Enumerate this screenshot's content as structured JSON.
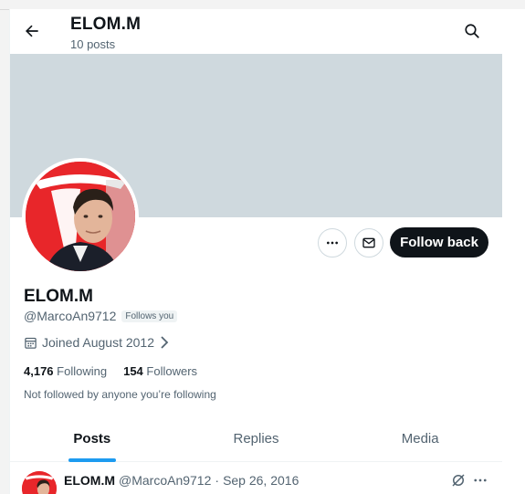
{
  "header": {
    "name": "ELOM.M",
    "posts_count": "10 posts"
  },
  "profile": {
    "display_name": "ELOM.M",
    "handle": "@MarcoAn9712",
    "follows_you": "Follows you",
    "joined": "Joined August 2012",
    "following_count": "4,176",
    "following_label": "Following",
    "followers_count": "154",
    "followers_label": "Followers",
    "not_followed": "Not followed by anyone you’re following"
  },
  "actions": {
    "follow_label": "Follow back"
  },
  "tabs": [
    {
      "label": "Posts",
      "active": true
    },
    {
      "label": "Replies",
      "active": false
    },
    {
      "label": "Media",
      "active": false
    }
  ],
  "post": {
    "name": "ELOM.M",
    "handle": "@MarcoAn9712",
    "separator": "·",
    "date": "Sep 26, 2016"
  },
  "colors": {
    "accent": "#1d9bf0",
    "banner": "#cfd9de",
    "follow_button": "#0f1419",
    "avatar_bg": "#e8262a"
  },
  "icons": {
    "back": "arrow-left-icon",
    "search": "search-icon",
    "more": "more-horizontal-icon",
    "message": "envelope-icon",
    "calendar": "calendar-icon",
    "chevron": "chevron-right-icon"
  }
}
